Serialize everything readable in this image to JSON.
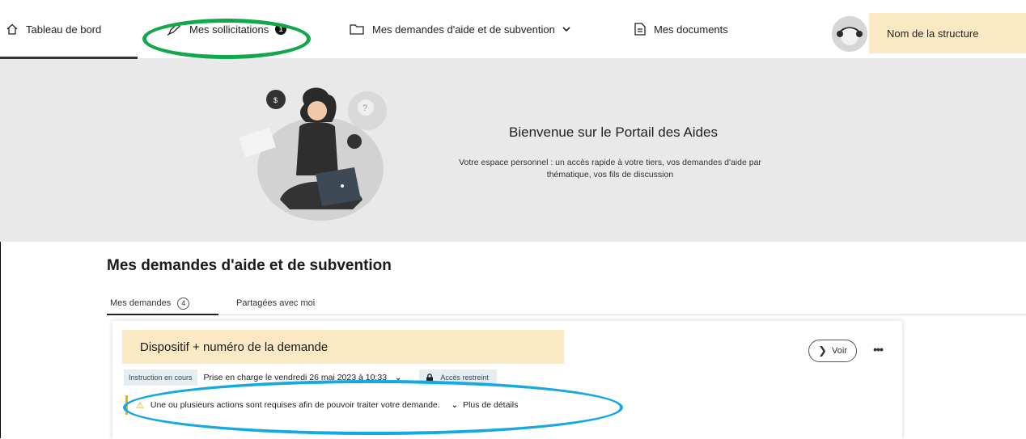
{
  "nav": {
    "dashboard": "Tableau de bord",
    "solicitations": "Mes sollicitations",
    "solicitations_count": "1",
    "requests": "Mes demandes d'aide et de subvention",
    "documents": "Mes documents",
    "structure": "Nom de la structure"
  },
  "hero": {
    "title": "Bienvenue sur le Portail des Aides",
    "description": "Votre espace personnel : un accès rapide à votre tiers, vos demandes d'aide par thématique, vos fils de discussion"
  },
  "section": {
    "title": "Mes demandes d'aide et de subvention",
    "tabs": [
      {
        "label": "Mes demandes",
        "count": "4"
      },
      {
        "label": "Partagées avec moi"
      }
    ]
  },
  "card": {
    "title": "Dispositif + numéro de la demande",
    "voir_label": "Voir",
    "more_label": "•••",
    "status": "Instruction en cours",
    "prise_en_charge": "Prise en charge le vendredi 26 mai 2023 à 10:33",
    "access": "Accès restreint",
    "alert": "Une ou plusieurs actions sont requises afin de pouvoir traiter votre demande.",
    "details_label": "Plus de détails"
  },
  "colors": {
    "accent_yellow": "#fbe9c3",
    "annotation_green": "#12a84a",
    "annotation_blue": "#14a9e3",
    "badge_blue": "#e3edf2"
  }
}
